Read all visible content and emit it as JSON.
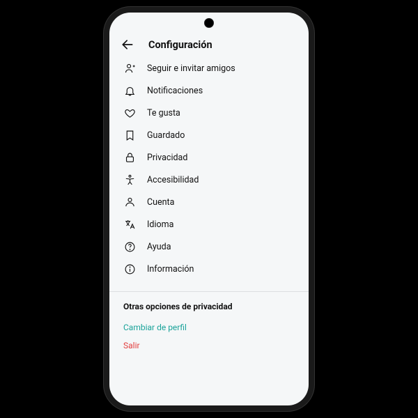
{
  "header": {
    "title": "Configuración"
  },
  "menu": [
    {
      "id": "follow-invite",
      "icon": "person-plus-icon",
      "label": "Seguir e invitar amigos"
    },
    {
      "id": "notifications",
      "icon": "bell-icon",
      "label": "Notificaciones"
    },
    {
      "id": "likes",
      "icon": "heart-icon",
      "label": "Te gusta"
    },
    {
      "id": "saved",
      "icon": "bookmark-icon",
      "label": "Guardado"
    },
    {
      "id": "privacy",
      "icon": "lock-icon",
      "label": "Privacidad"
    },
    {
      "id": "accessibility",
      "icon": "accessibility-icon",
      "label": "Accesibilidad"
    },
    {
      "id": "account",
      "icon": "person-icon",
      "label": "Cuenta"
    },
    {
      "id": "language",
      "icon": "translate-icon",
      "label": "Idioma"
    },
    {
      "id": "help",
      "icon": "help-icon",
      "label": "Ayuda"
    },
    {
      "id": "info",
      "icon": "info-icon",
      "label": "Información"
    }
  ],
  "section": {
    "title": "Otras opciones de privacidad"
  },
  "links": {
    "switch_profile": "Cambiar de perfil",
    "logout": "Salir"
  },
  "colors": {
    "teal": "#1aa39a",
    "red": "#e23d3d"
  }
}
